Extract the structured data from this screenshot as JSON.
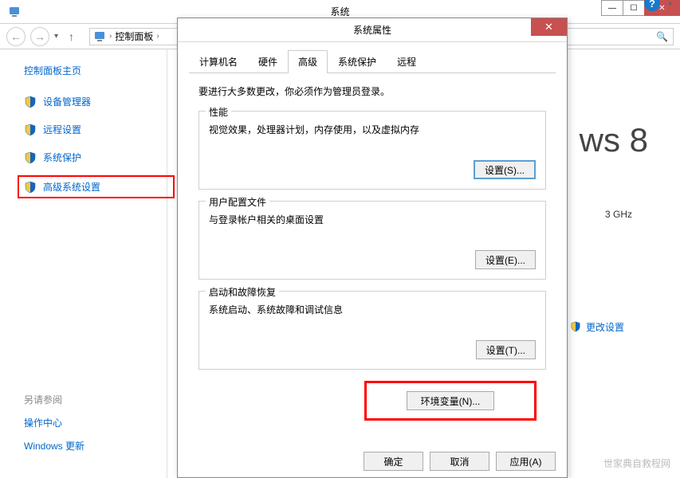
{
  "mainWindow": {
    "title": "系统",
    "breadcrumb": {
      "item1": "控制面板",
      "sep": "›"
    }
  },
  "sidebar": {
    "title": "控制面板主页",
    "items": [
      {
        "label": "设备管理器"
      },
      {
        "label": "远程设置"
      },
      {
        "label": "系统保护"
      },
      {
        "label": "高级系统设置"
      }
    ],
    "footer": {
      "title": "另请参阅",
      "links": [
        "操作中心",
        "Windows 更新"
      ]
    }
  },
  "mainPanel": {
    "osBrand": "ws 8",
    "ghz": "3 GHz",
    "changeLink": "更改设置"
  },
  "dialog": {
    "title": "系统属性",
    "tabs": [
      "计算机名",
      "硬件",
      "高级",
      "系统保护",
      "远程"
    ],
    "adminNote": "要进行大多数更改，你必须作为管理员登录。",
    "groups": {
      "perf": {
        "title": "性能",
        "desc": "视觉效果，处理器计划，内存使用，以及虚拟内存",
        "btn": "设置(S)..."
      },
      "profile": {
        "title": "用户配置文件",
        "desc": "与登录帐户相关的桌面设置",
        "btn": "设置(E)..."
      },
      "startup": {
        "title": "启动和故障恢复",
        "desc": "系统启动、系统故障和调试信息",
        "btn": "设置(T)..."
      }
    },
    "envBtn": "环境变量(N)...",
    "footer": {
      "ok": "确定",
      "cancel": "取消",
      "apply": "应用(A)"
    }
  },
  "watermark": "世家典自救程网"
}
